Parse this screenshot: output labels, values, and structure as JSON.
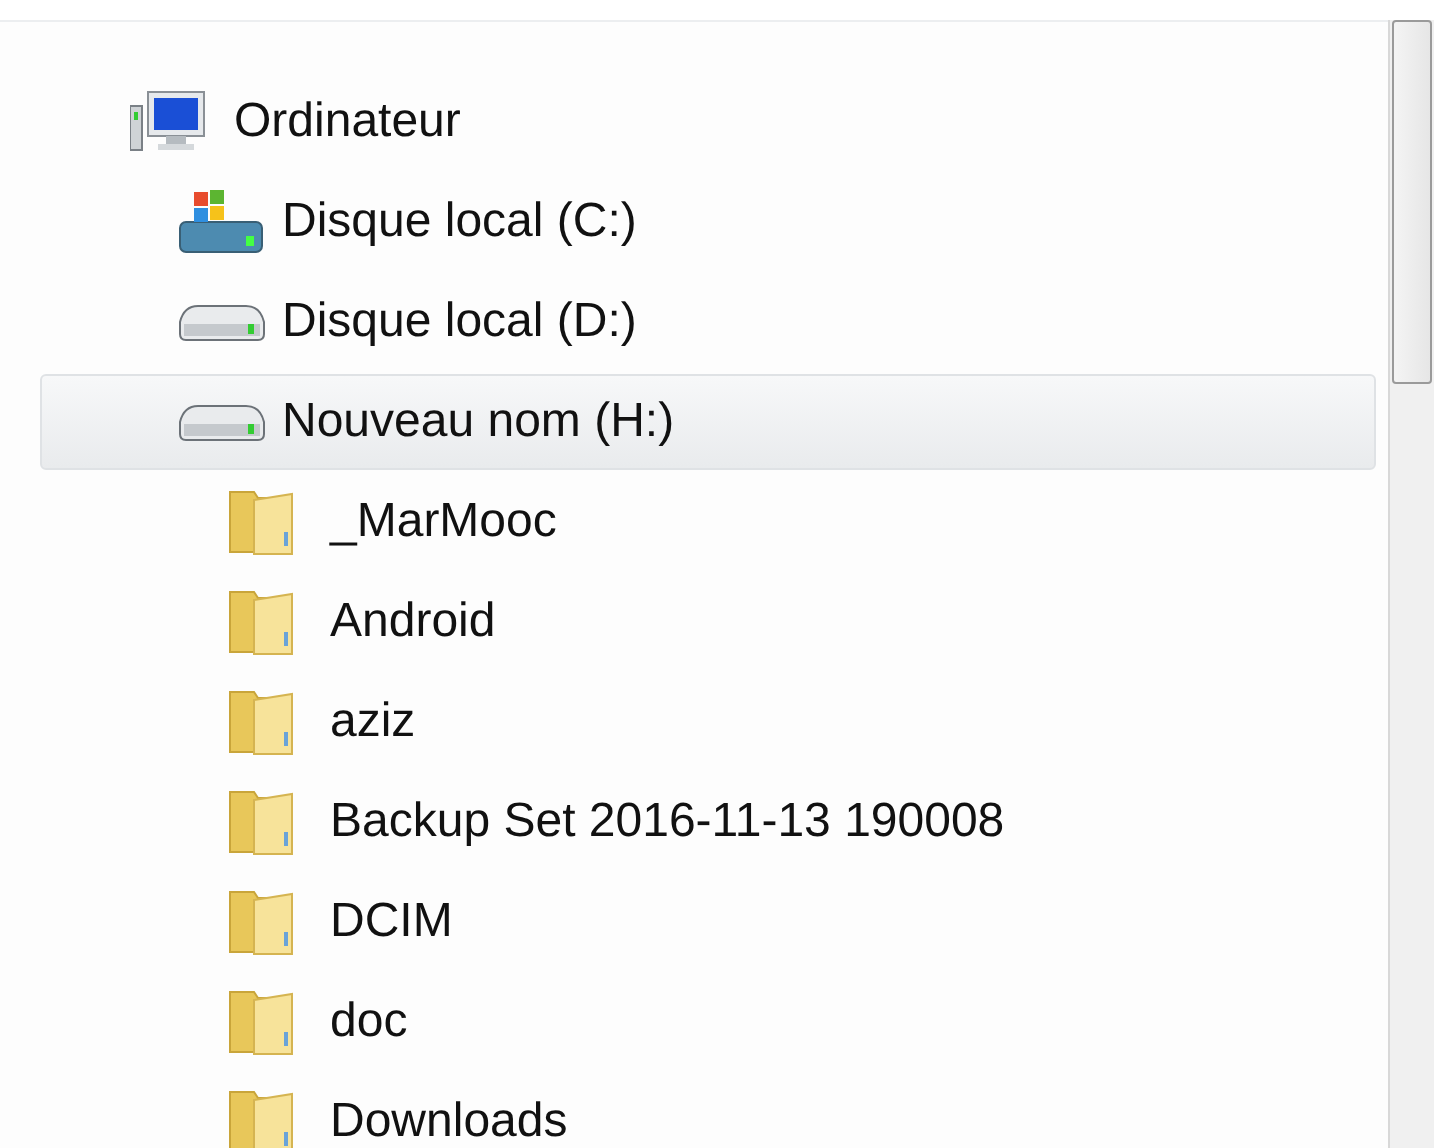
{
  "tree": [
    {
      "label": "Ordinateur",
      "kind": "computer",
      "selected": false,
      "children": [
        {
          "label": "Disque local (C:)",
          "kind": "system-drive",
          "selected": false
        },
        {
          "label": "Disque local (D:)",
          "kind": "drive",
          "selected": false
        },
        {
          "label": "Nouveau nom (H:)",
          "kind": "drive",
          "selected": true,
          "children": [
            {
              "label": "_MarMooc",
              "kind": "folder",
              "selected": false
            },
            {
              "label": "Android",
              "kind": "folder",
              "selected": false
            },
            {
              "label": "aziz",
              "kind": "folder",
              "selected": false
            },
            {
              "label": "Backup Set 2016-11-13 190008",
              "kind": "folder",
              "selected": false
            },
            {
              "label": "DCIM",
              "kind": "folder",
              "selected": false
            },
            {
              "label": "doc",
              "kind": "folder",
              "selected": false
            },
            {
              "label": "Downloads",
              "kind": "folder",
              "selected": false
            }
          ]
        }
      ]
    }
  ]
}
